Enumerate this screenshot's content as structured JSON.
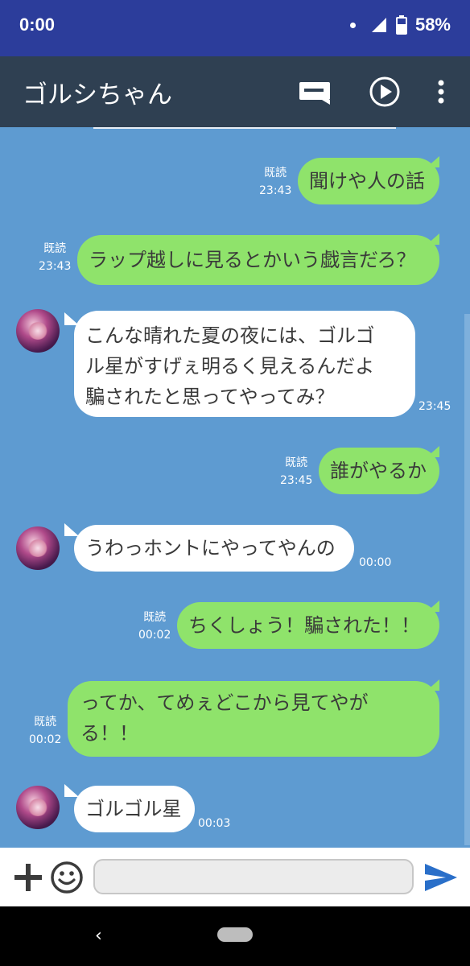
{
  "status_bar": {
    "time": "0:00",
    "battery": "58%"
  },
  "app_bar": {
    "title": "ゴルシちゃん",
    "icons": [
      "message-icon",
      "play-icon",
      "more-vert-icon"
    ]
  },
  "messages": [
    {
      "dir": "out",
      "lines": [
        "聞けや人の話"
      ],
      "read": "既読",
      "time": "23:43"
    },
    {
      "dir": "out",
      "lines": [
        "ラップ越しに見るとかいう戯言だろ？"
      ],
      "read": "既読",
      "time": "23:43"
    },
    {
      "dir": "in",
      "lines": [
        "こんな晴れた夏の夜には、ゴルゴ",
        "ル星がすげぇ明るく見えるんだよ",
        "騙されたと思ってやってみ？"
      ],
      "time": "23:45"
    },
    {
      "dir": "out",
      "lines": [
        "誰がやるか"
      ],
      "read": "既読",
      "time": "23:45"
    },
    {
      "dir": "in",
      "lines": [
        "うわっホントにやってやんの"
      ],
      "time": "00:00"
    },
    {
      "dir": "out",
      "lines": [
        "ちくしょう！騙された！！"
      ],
      "read": "既読",
      "time": "00:02"
    },
    {
      "dir": "out",
      "lines": [
        "ってか、てめぇどこから見てやが",
        "る！！"
      ],
      "read": "既読",
      "time": "00:02"
    },
    {
      "dir": "in",
      "lines": [
        "ゴルゴル星"
      ],
      "time": "00:03"
    }
  ],
  "input_bar": {
    "text_value": "",
    "icons": [
      "plus-icon",
      "emoji-icon",
      "send-icon"
    ]
  },
  "colors": {
    "status_bar": "#2c3d9b",
    "app_bar": "#2f4052",
    "chat_background": "#5e9bd1",
    "outgoing_bubble": "#8fe36b",
    "incoming_bubble": "#ffffff",
    "send_icon": "#2a6fc9"
  }
}
